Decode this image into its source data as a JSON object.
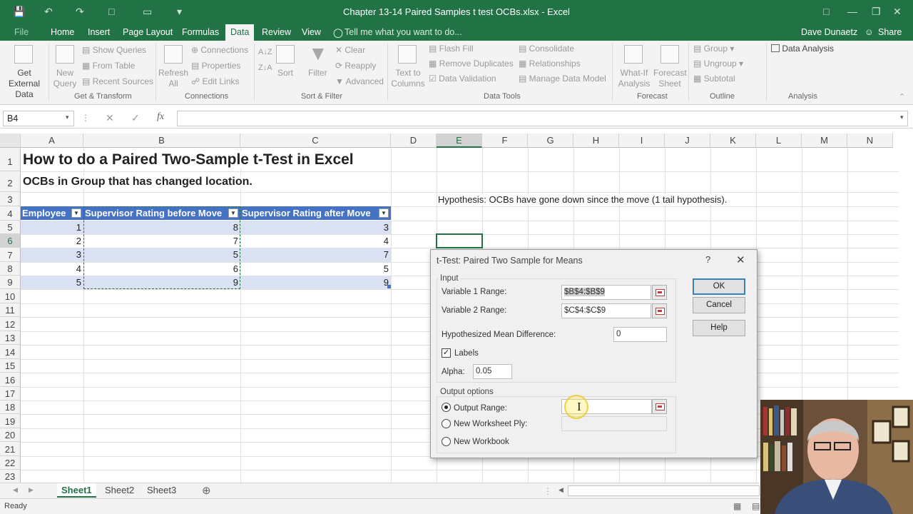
{
  "window": {
    "title": "Chapter 13-14 Paired Samples t test OCBs.xlsx  -  Excel"
  },
  "ribbon_tabs": [
    "File",
    "Home",
    "Insert",
    "Page Layout",
    "Formulas",
    "Data",
    "Review",
    "View"
  ],
  "tell_me": "Tell me what you want to do...",
  "user": "Dave Dunaetz",
  "share": "Share",
  "ribbon": {
    "get_external": "Get External Data",
    "new_query": "New Query",
    "show_queries": "Show Queries",
    "from_table": "From Table",
    "recent_sources": "Recent Sources",
    "group_get_transform": "Get & Transform",
    "refresh_all": "Refresh All",
    "connections": "Connections",
    "properties": "Properties",
    "edit_links": "Edit Links",
    "group_connections": "Connections",
    "sort": "Sort",
    "filter": "Filter",
    "clear": "Clear",
    "reapply": "Reapply",
    "advanced": "Advanced",
    "group_sort_filter": "Sort & Filter",
    "text_to_columns": "Text to Columns",
    "flash_fill": "Flash Fill",
    "remove_duplicates": "Remove Duplicates",
    "data_validation": "Data Validation",
    "consolidate": "Consolidate",
    "relationships": "Relationships",
    "manage_data_model": "Manage Data Model",
    "group_data_tools": "Data Tools",
    "what_if": "What-If Analysis",
    "forecast_sheet": "Forecast Sheet",
    "group_forecast": "Forecast",
    "group": "Group",
    "ungroup": "Ungroup",
    "subtotal": "Subtotal",
    "group_outline": "Outline",
    "data_analysis": "Data Analysis",
    "group_analysis": "Analysis"
  },
  "formula_bar": {
    "name_box": "B4",
    "fx": "fx",
    "value": ""
  },
  "columns": [
    "A",
    "B",
    "C",
    "D",
    "E",
    "F",
    "G",
    "H",
    "I",
    "J",
    "K",
    "L",
    "M",
    "N"
  ],
  "rows": [
    "1",
    "2",
    "3",
    "4",
    "5",
    "6",
    "7",
    "8",
    "9",
    "10",
    "11",
    "12",
    "13",
    "14",
    "15",
    "16",
    "17",
    "18",
    "19",
    "20",
    "21",
    "22",
    "23"
  ],
  "sheet": {
    "title": "How to do a Paired Two-Sample t-Test in Excel",
    "subtitle": "OCBs in Group that has changed location.",
    "hypothesis": "Hypothesis: OCBs have gone down since the move (1 tail hypothesis).",
    "headers": [
      "Employee",
      "Supervisor Rating before Move",
      "Supervisor Rating after Move"
    ],
    "data": [
      [
        "1",
        "8",
        "3"
      ],
      [
        "2",
        "7",
        "4"
      ],
      [
        "3",
        "5",
        "7"
      ],
      [
        "4",
        "6",
        "5"
      ],
      [
        "5",
        "9",
        "9"
      ]
    ]
  },
  "dialog": {
    "title": "t-Test: Paired Two Sample for Means",
    "help_icon": "?",
    "input_label": "Input",
    "var1_label": "Variable 1 Range:",
    "var1_value": "$B$4:$B$9",
    "var2_label": "Variable 2 Range:",
    "var2_value": "$C$4:$C$9",
    "hyp_label": "Hypothesized Mean Difference:",
    "hyp_value": "0",
    "labels_label": "Labels",
    "alpha_label": "Alpha:",
    "alpha_value": "0.05",
    "output_label": "Output options",
    "output_range_label": "Output Range:",
    "new_ws_label": "New Worksheet Ply:",
    "new_wb_label": "New Workbook",
    "ok": "OK",
    "cancel": "Cancel",
    "help": "Help"
  },
  "sheet_tabs": [
    "Sheet1",
    "Sheet2",
    "Sheet3"
  ],
  "status": "Ready",
  "colors": {
    "excel_green": "#217346",
    "table_header": "#4472c4",
    "table_band": "#d9e1f2"
  }
}
